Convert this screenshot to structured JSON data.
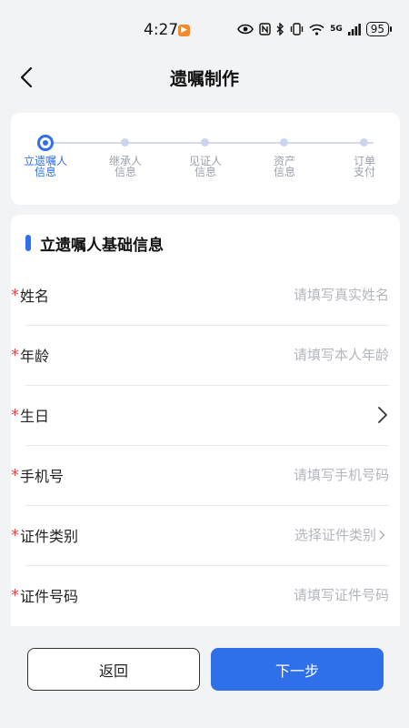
{
  "status_bar": {
    "time": "4:27",
    "app_badge": "▶",
    "network": "5G",
    "battery": "95"
  },
  "header": {
    "title": "遗嘱制作"
  },
  "steps": [
    {
      "line1": "立遗嘱人",
      "line2": "信息",
      "active": true
    },
    {
      "line1": "继承人",
      "line2": "信息",
      "active": false
    },
    {
      "line1": "见证人",
      "line2": "信息",
      "active": false
    },
    {
      "line1": "资产",
      "line2": "信息",
      "active": false
    },
    {
      "line1": "订单",
      "line2": "支付",
      "active": false
    }
  ],
  "form": {
    "section_title": "立遗嘱人基础信息",
    "required_mark": "*",
    "fields": [
      {
        "label": "姓名",
        "placeholder": "请填写真实姓名",
        "chevron": false
      },
      {
        "label": "年龄",
        "placeholder": "请填写本人年龄",
        "chevron": false
      },
      {
        "label": "生日",
        "placeholder": "",
        "chevron": true
      },
      {
        "label": "手机号",
        "placeholder": "请填写手机号码",
        "chevron": false
      },
      {
        "label": "证件类别",
        "placeholder": "选择证件类别",
        "chevron": true
      },
      {
        "label": "证件号码",
        "placeholder": "请填写证件号码",
        "chevron": false
      }
    ]
  },
  "buttons": {
    "back": "返回",
    "next": "下一步"
  },
  "colors": {
    "accent": "#2f6fea",
    "required": "#e5484d",
    "background": "#f2f3f5"
  }
}
